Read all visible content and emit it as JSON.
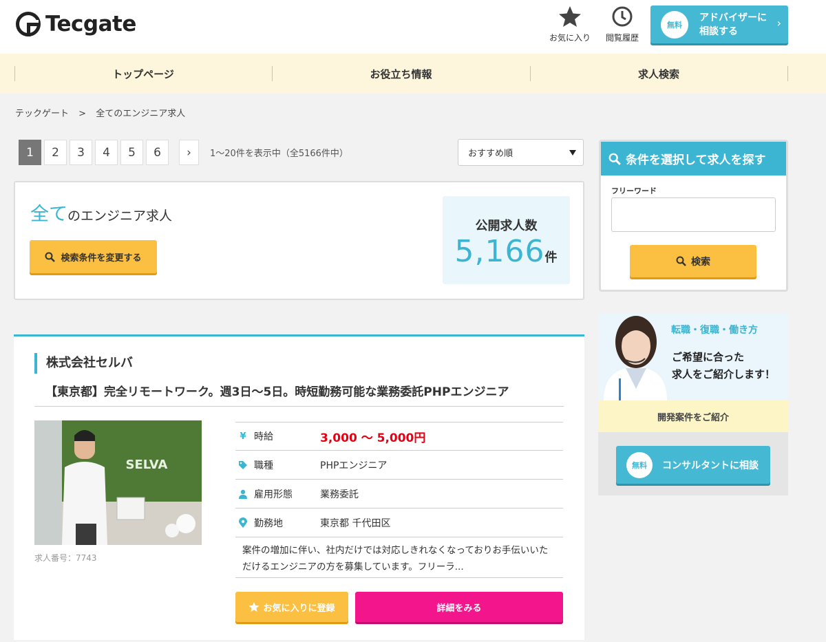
{
  "header": {
    "logo_text": "Tecgate",
    "favorites_label": "お気に入り",
    "history_label": "閲覧履歴",
    "advisor": {
      "badge": "無料",
      "line1": "アドバイザーに",
      "line2": "相談する"
    }
  },
  "nav": {
    "items": [
      "トップページ",
      "お役立ち情報",
      "求人検索"
    ]
  },
  "breadcrumb": {
    "home": "テックゲート",
    "sep": ">",
    "current": "全てのエンジニア求人"
  },
  "pagination": {
    "pages": [
      "1",
      "2",
      "3",
      "4",
      "5",
      "6"
    ],
    "current": "1",
    "next": "›",
    "info": "1〜20件を表示中（全5166件中）"
  },
  "sort": {
    "selected": "おすすめ順"
  },
  "summary": {
    "title_accent": "全て",
    "title_rest": "のエンジニア求人",
    "change_button": "検索条件を変更する",
    "count_label": "公開求人数",
    "count_value": "5,166",
    "count_unit": "件"
  },
  "job": {
    "company": "株式会社セルバ",
    "title": "【東京都】完全リモートワーク。週3日〜5日。時短勤務可能な業務委託PHPエンジニア",
    "photo_sign": "SELVA",
    "job_number": "求人番号：7743",
    "rows": [
      {
        "icon": "yen-icon",
        "label": "時給",
        "value": "3,000 〜 5,000円"
      },
      {
        "icon": "tag-icon",
        "label": "職種",
        "value": "PHPエンジニア"
      },
      {
        "icon": "person-icon",
        "label": "雇用形態",
        "value": "業務委託"
      },
      {
        "icon": "map-pin-icon",
        "label": "勤務地",
        "value": "東京都 千代田区"
      }
    ],
    "description": "案件の増加に伴い、社内だけでは対応しきれなくなっておりお手伝いいただけるエンジニアの方を募集しています。フリーラ...",
    "favorite_button": "お気に入りに登録",
    "detail_button": "詳細をみる"
  },
  "sidebar": {
    "search": {
      "heading": "条件を選択して求人を探す",
      "freeword_label": "フリーワード",
      "freeword_value": "",
      "button": "検索"
    },
    "banner": {
      "tagline": "転職・復職・働き方",
      "msg_line1": "ご希望に合った",
      "msg_line2": "求人をご紹介します！",
      "strip": "開発案件をご紹介",
      "consult_badge": "無料",
      "consult_label": "コンサルタントに相談"
    }
  },
  "colors": {
    "accent": "#3bb5d2",
    "yellow": "#fbbf42",
    "pink": "#f2158c",
    "salary": "#e60012",
    "nav_bg": "#fdf6dc"
  }
}
